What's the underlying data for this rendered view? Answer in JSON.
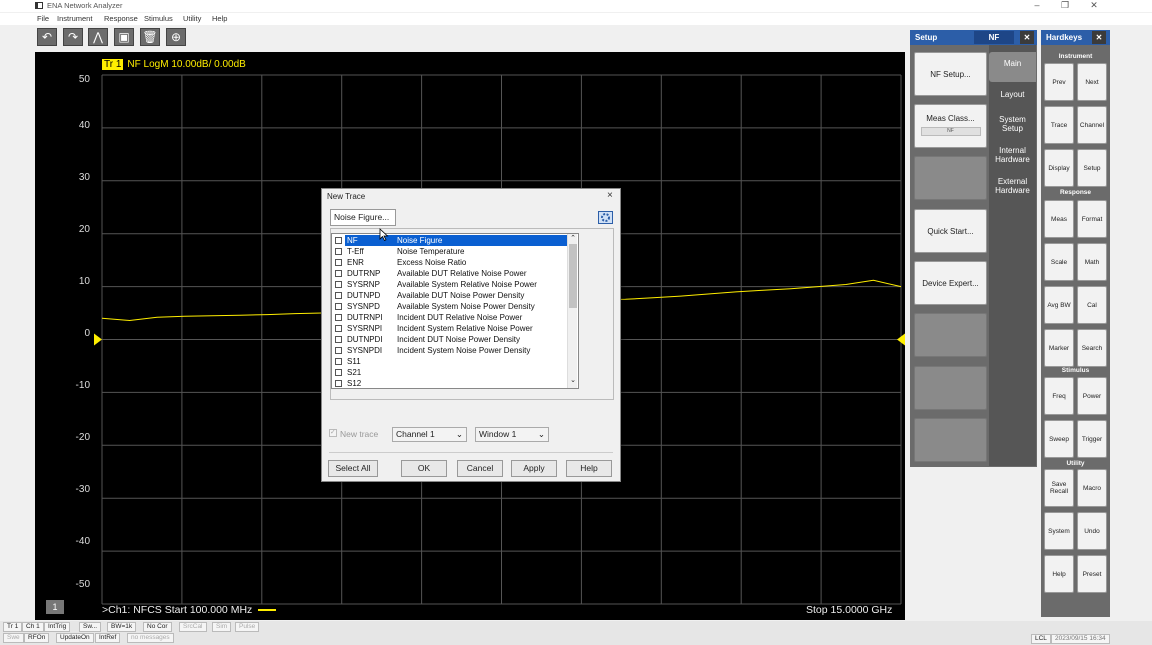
{
  "app": {
    "title": "ENA Network Analyzer"
  },
  "menu": [
    "File",
    "Instrument",
    "Response",
    "Stimulus",
    "Utility",
    "Help"
  ],
  "toolbar": {
    "icons": [
      "undo-icon",
      "redo-icon",
      "marker-icon",
      "screen-icon",
      "delete-icon",
      "zoom-icon"
    ],
    "glyphs": [
      "↶",
      "↷",
      "⋀",
      "▣",
      "🗑",
      "⊕"
    ]
  },
  "chart": {
    "trace_tag": "Tr 1",
    "trace_label": "NF LogM 10.00dB/ 0.00dB",
    "yticks": [
      "50",
      "40",
      "30",
      "20",
      "10",
      "0",
      "-10",
      "-20",
      "-30",
      "-40",
      "-50"
    ],
    "channel_number": "1",
    "start_label": ">Ch1: NFCS  Start  100.000 MHz",
    "stop_label": "Stop  15.0000 GHz",
    "trace_color": "#ffee00",
    "grid_color": "#555555"
  },
  "chart_data": {
    "type": "line",
    "title": "NF LogM 10.00dB/ 0.00dB",
    "x_start": "100.000 MHz",
    "x_stop": "15.0000 GHz",
    "ylim": [
      -50,
      50
    ],
    "ytick_step": 10,
    "series": [
      {
        "name": "Tr 1",
        "x_points": 30,
        "values": [
          4.0,
          3.6,
          4.2,
          4.4,
          4.5,
          4.6,
          4.7,
          4.9,
          5.0,
          5.2,
          5.4,
          5.6,
          5.8,
          6.2,
          6.5,
          6.8,
          7.0,
          7.3,
          7.5,
          7.6,
          7.9,
          8.2,
          8.6,
          9.0,
          9.3,
          9.6,
          10.0,
          10.4,
          11.2,
          10.0
        ]
      }
    ]
  },
  "dialog": {
    "title": "New Trace",
    "close": "×",
    "tab": "Noise Figure...",
    "items": [
      {
        "code": "NF",
        "desc": "Noise Figure",
        "selected": true
      },
      {
        "code": "T-Eff",
        "desc": "Noise Temperature"
      },
      {
        "code": "ENR",
        "desc": "Excess Noise Ratio"
      },
      {
        "code": "DUTRNP",
        "desc": "Available DUT Relative Noise Power"
      },
      {
        "code": "SYSRNP",
        "desc": "Available System Relative Noise Power"
      },
      {
        "code": "DUTNPD",
        "desc": "Available DUT Noise Power Density"
      },
      {
        "code": "SYSNPD",
        "desc": "Available System Noise Power Density"
      },
      {
        "code": "DUTRNPI",
        "desc": "Incident DUT Relative Noise Power"
      },
      {
        "code": "SYSRNPI",
        "desc": "Incident System Relative Noise Power"
      },
      {
        "code": "DUTNPDI",
        "desc": "Incident DUT Noise Power Density"
      },
      {
        "code": "SYSNPDI",
        "desc": "Incident System Noise Power Density"
      },
      {
        "code": "S11",
        "desc": ""
      },
      {
        "code": "S21",
        "desc": ""
      },
      {
        "code": "S12",
        "desc": ""
      }
    ],
    "new_trace_label": "New trace",
    "channel_value": "Channel 1",
    "window_value": "Window 1",
    "select_all": "Select All",
    "ok": "OK",
    "cancel": "Cancel",
    "apply": "Apply",
    "help": "Help"
  },
  "setup": {
    "title": "Setup",
    "context": "NF",
    "close": "✕",
    "buttons": [
      "NF Setup...",
      "Meas Class...",
      "",
      "Quick Start...",
      "Device Expert...",
      "",
      "",
      ""
    ],
    "meas_class_value": "NF",
    "tabs": [
      "Main",
      "Layout",
      "System\nSetup",
      "Internal\nHardware",
      "External\nHardware"
    ]
  },
  "hardkeys": {
    "title": "Hardkeys",
    "close": "✕",
    "groups": [
      {
        "label": "Instrument",
        "buttons": [
          "Prev",
          "Next",
          "Trace",
          "Channel",
          "Display",
          "Setup"
        ]
      },
      {
        "label": "Response",
        "buttons": [
          "Meas",
          "Format",
          "Scale",
          "Math",
          "Avg BW",
          "Cal",
          "Marker",
          "Search"
        ]
      },
      {
        "label": "Stimulus",
        "buttons": [
          "Freq",
          "Power",
          "Sweep",
          "Trigger"
        ]
      },
      {
        "label": "Utility",
        "buttons": [
          "Save\nRecall",
          "Macro",
          "System",
          "Undo",
          "Help",
          "Preset"
        ]
      }
    ]
  },
  "status1": [
    "Tr 1",
    "Ch 1",
    "IntTrig",
    "Sw...",
    "BW=1k",
    "No Cor",
    "SrcCal",
    "Sim",
    "Pulse"
  ],
  "status2": [
    "Swe",
    "RFOn",
    "UpdateOn",
    "IntRef",
    "no messages"
  ],
  "status_right": {
    "lcl": "LCL",
    "datetime": "2023/09/15 16:34"
  }
}
